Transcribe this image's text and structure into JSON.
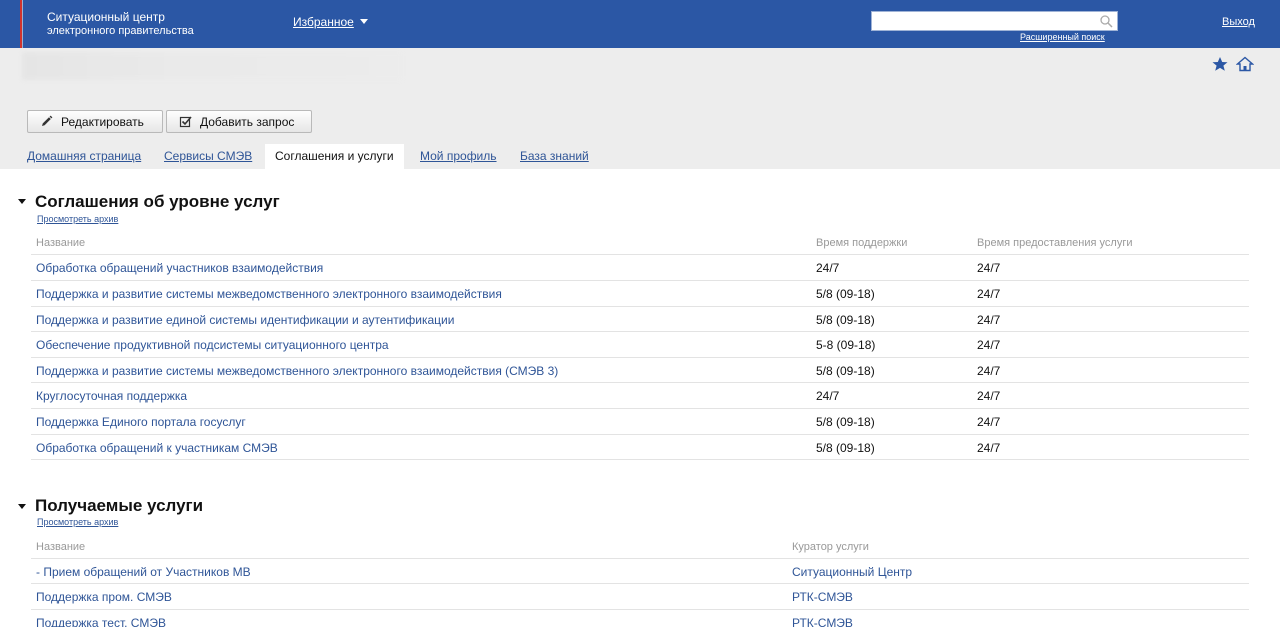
{
  "header": {
    "brand_line1": "Ситуационный центр",
    "brand_line2": "электронного правительства",
    "favorites_label": "Избранное",
    "search_placeholder": "",
    "advanced_search": "Расширенный поиск",
    "logout": "Выход",
    "colors": {
      "bar": "#2b57a5",
      "accent_stripe": "#d0332e"
    }
  },
  "toolbar": {
    "edit_label": "Редактировать",
    "add_request_label": "Добавить запрос"
  },
  "tabs": [
    {
      "label": "Домашняя страница"
    },
    {
      "label": "Сервисы СМЭВ"
    },
    {
      "label": "Соглашения и услуги",
      "active": true
    },
    {
      "label": "Мой профиль"
    },
    {
      "label": "База знаний"
    }
  ],
  "sla": {
    "title": "Соглашения об уровне услуг",
    "archive_link": "Просмотреть архив",
    "columns": [
      "Название",
      "Время поддержки",
      "Время предоставления услуги"
    ],
    "rows": [
      {
        "name": "Обработка обращений участников взаимодействия",
        "support": "24/7",
        "delivery": "24/7"
      },
      {
        "name": "Поддержка и развитие системы межведомственного электронного взаимодействия",
        "support": "5/8 (09-18)",
        "delivery": "24/7"
      },
      {
        "name": "Поддержка и развитие единой системы идентификации и аутентификации",
        "support": "5/8 (09-18)",
        "delivery": "24/7"
      },
      {
        "name": "Обеспечение продуктивной подсистемы ситуационного центра",
        "support": "5-8 (09-18)",
        "delivery": "24/7"
      },
      {
        "name": "Поддержка и развитие системы межведомственного электронного взаимодействия (СМЭВ 3)",
        "support": "5/8 (09-18)",
        "delivery": "24/7"
      },
      {
        "name": "Круглосуточная поддержка",
        "support": "24/7",
        "delivery": "24/7"
      },
      {
        "name": "Поддержка Единого портала госуслуг",
        "support": "5/8 (09-18)",
        "delivery": "24/7"
      },
      {
        "name": "Обработка обращений к участникам СМЭВ",
        "support": "5/8 (09-18)",
        "delivery": "24/7"
      }
    ]
  },
  "received": {
    "title": "Получаемые услуги",
    "archive_link": "Просмотреть архив",
    "columns": [
      "Название",
      "Куратор услуги"
    ],
    "rows": [
      {
        "name": "- Прием обращений от Участников МВ",
        "curator": "Ситуационный Центр"
      },
      {
        "name": "Поддержка пром. СМЭВ",
        "curator": "РТК-СМЭВ"
      },
      {
        "name": "Поддержка тест. СМЭВ",
        "curator": "РТК-СМЭВ"
      }
    ]
  },
  "icons": {
    "star": "star-icon",
    "home": "home-icon",
    "search": "search-icon",
    "pencil": "pencil-icon",
    "checkbox": "checkbox-icon"
  }
}
